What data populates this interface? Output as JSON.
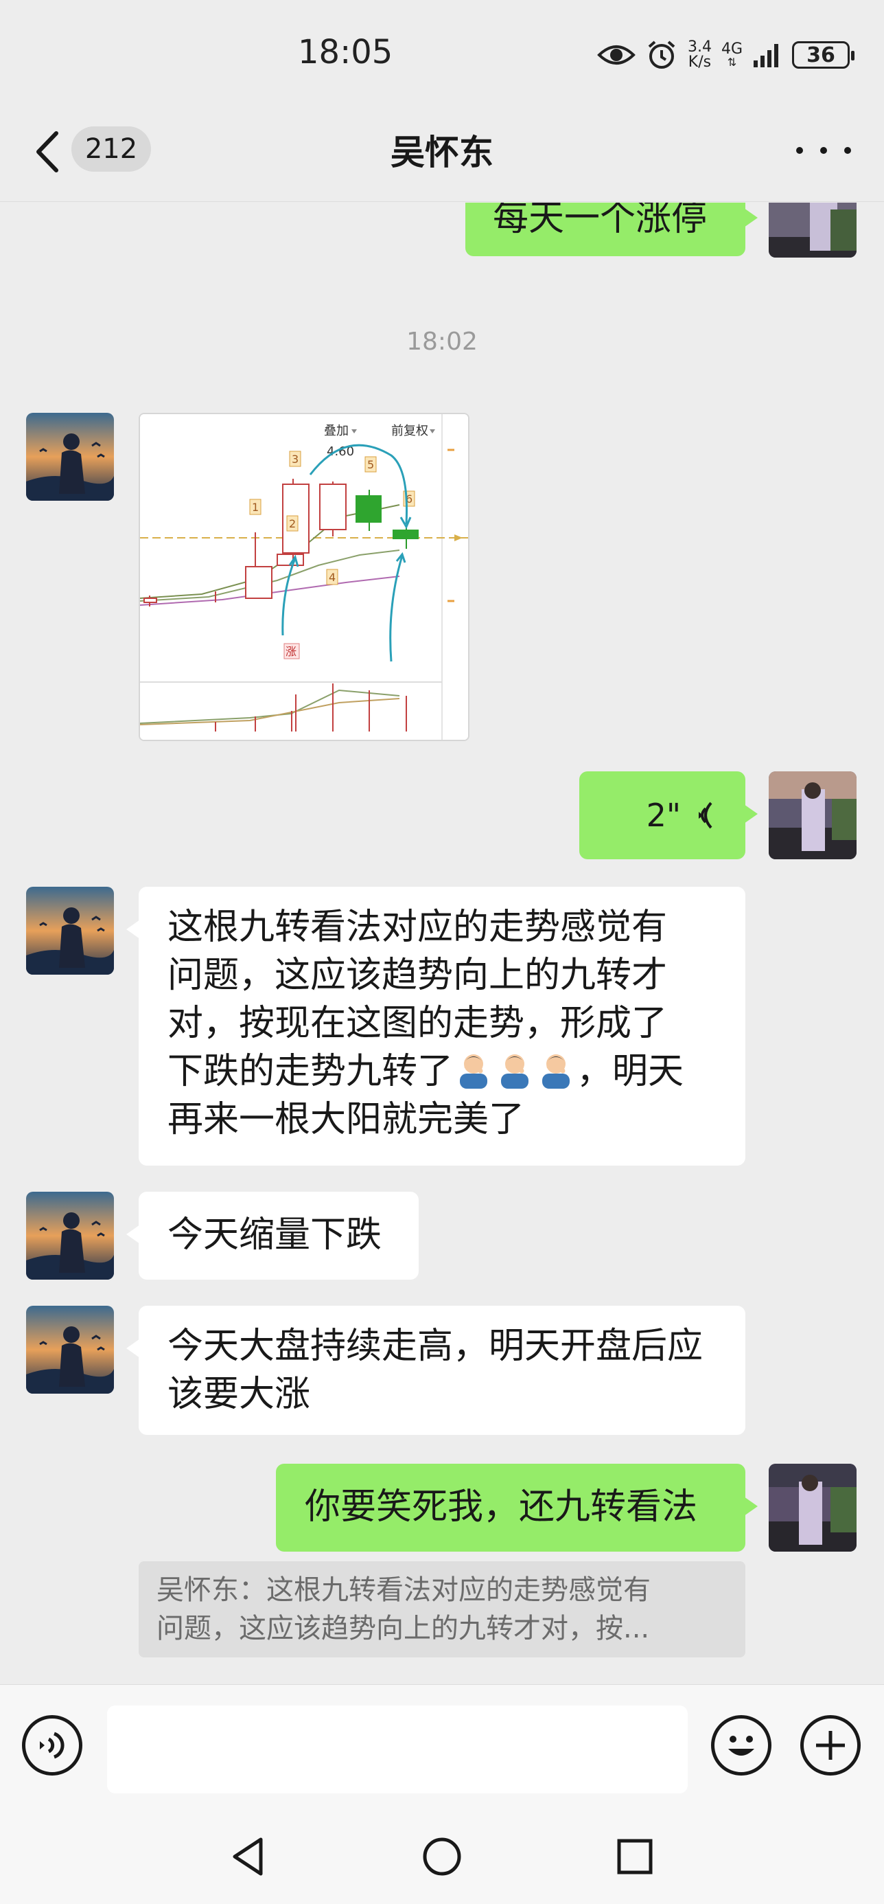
{
  "status_bar": {
    "time": "18:05",
    "speed_value": "3.4",
    "speed_unit": "K/s",
    "network": "4G",
    "battery": "36",
    "icons": [
      "eye-icon",
      "alarm-icon",
      "signal-icon",
      "battery-icon"
    ]
  },
  "header": {
    "back_icon": "chevron-left-icon",
    "unread_count": "212",
    "title": "吴怀东",
    "more_icon": "more-dots-icon"
  },
  "messages": {
    "m0_text": "每天一个涨停",
    "time_divider": "18:02",
    "m1_type": "image",
    "m1_chart_labels": {
      "overlay": "叠加",
      "adjust": "前复权",
      "price": "4.60",
      "n1": "1",
      "n2": "2",
      "n3": "3",
      "n4": "4",
      "n5": "5",
      "n6": "6",
      "limit_up": "涨"
    },
    "m2_voice_duration": "2\"",
    "m3_text_line1": "这根九转看法对应的走势感觉有",
    "m3_text_line2": "问题，这应该趋势向上的九转才",
    "m3_text_line3": "对，按现在这图的走势，形成了",
    "m3_text_line4a": "下跌的走势九转了",
    "m3_text_line4b": "，明天",
    "m3_text_line5": "再来一根大阳就完美了",
    "m4_text": "今天缩量下跌",
    "m5_text_line1": "今天大盘持续走高，明天开盘后应",
    "m5_text_line2": "该要大涨",
    "m6_text": "你要笑死我，还九转看法",
    "m6_quote_line1": "吴怀东：这根九转看法对应的走势感觉有",
    "m6_quote_line2": "问题，这应该趋势向上的九转才对，按..."
  },
  "input_bar": {
    "voice_icon": "voice-icon",
    "input_value": "",
    "emoji_icon": "emoji-icon",
    "plus_icon": "plus-icon"
  },
  "system_nav": {
    "back": "triangle-back-icon",
    "home": "circle-home-icon",
    "recent": "square-recent-icon"
  },
  "colors": {
    "background": "#ededed",
    "bubble_mine": "#95ec69",
    "bubble_other": "#ffffff",
    "time_text": "#9a9a9a"
  }
}
